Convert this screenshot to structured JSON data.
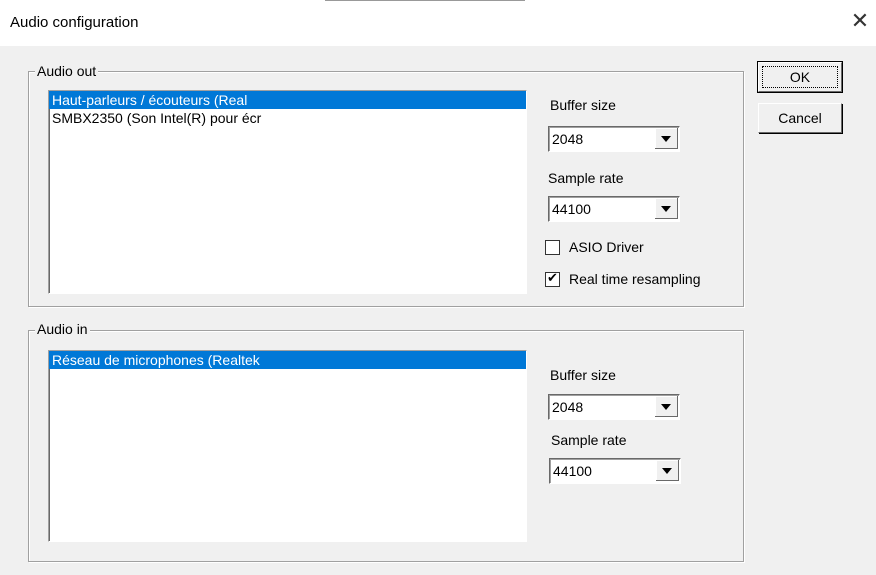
{
  "window": {
    "title": "Audio configuration",
    "close_glyph": "✕"
  },
  "buttons": {
    "ok": "OK",
    "cancel": "Cancel"
  },
  "audio_out": {
    "legend": "Audio out",
    "devices": [
      {
        "label": "Haut-parleurs / écouteurs (Real",
        "selected": true
      },
      {
        "label": "SMBX2350 (Son Intel(R) pour écr",
        "selected": false
      }
    ],
    "buffer_size_label": "Buffer size",
    "buffer_size_value": "2048",
    "sample_rate_label": "Sample rate",
    "sample_rate_value": "44100",
    "asio_label": "ASIO Driver",
    "asio_checked": false,
    "resampling_label": "Real time resampling",
    "resampling_checked": true,
    "check_glyph": "✔"
  },
  "audio_in": {
    "legend": "Audio in",
    "devices": [
      {
        "label": "Réseau de microphones (Realtek",
        "selected": true
      }
    ],
    "buffer_size_label": "Buffer size",
    "buffer_size_value": "2048",
    "sample_rate_label": "Sample rate",
    "sample_rate_value": "44100"
  },
  "colors": {
    "selection": "#0078d7",
    "dialog_bg": "#f0f0f0"
  }
}
